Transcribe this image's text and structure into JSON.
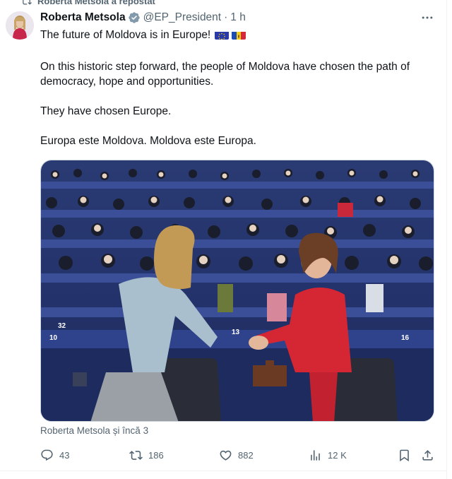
{
  "repost_banner": {
    "text": "Roberta Metsola a repostat"
  },
  "tweet": {
    "author_name": "Roberta Metsola",
    "handle": "@EP_President",
    "separator": "·",
    "time": "1 h",
    "line1": "The future of Moldova is in Europe!",
    "paragraph2": "On this historic step forward, the people of Moldova have chosen the path of democracy, hope and opportunities.",
    "paragraph3": "They have chosen Europe.",
    "paragraph4": "Europa este Moldova. Moldova este Europa.",
    "media_caption": "Roberta Metsola și încă 3",
    "flags": [
      "eu-flag-emoji",
      "moldova-flag-emoji"
    ]
  },
  "actions": {
    "replies": "43",
    "reposts": "186",
    "likes": "882",
    "views": "12 K"
  },
  "colors": {
    "text": "#0f1419",
    "secondary": "#536471",
    "verified": "#829aab",
    "border": "#cfd9de"
  }
}
